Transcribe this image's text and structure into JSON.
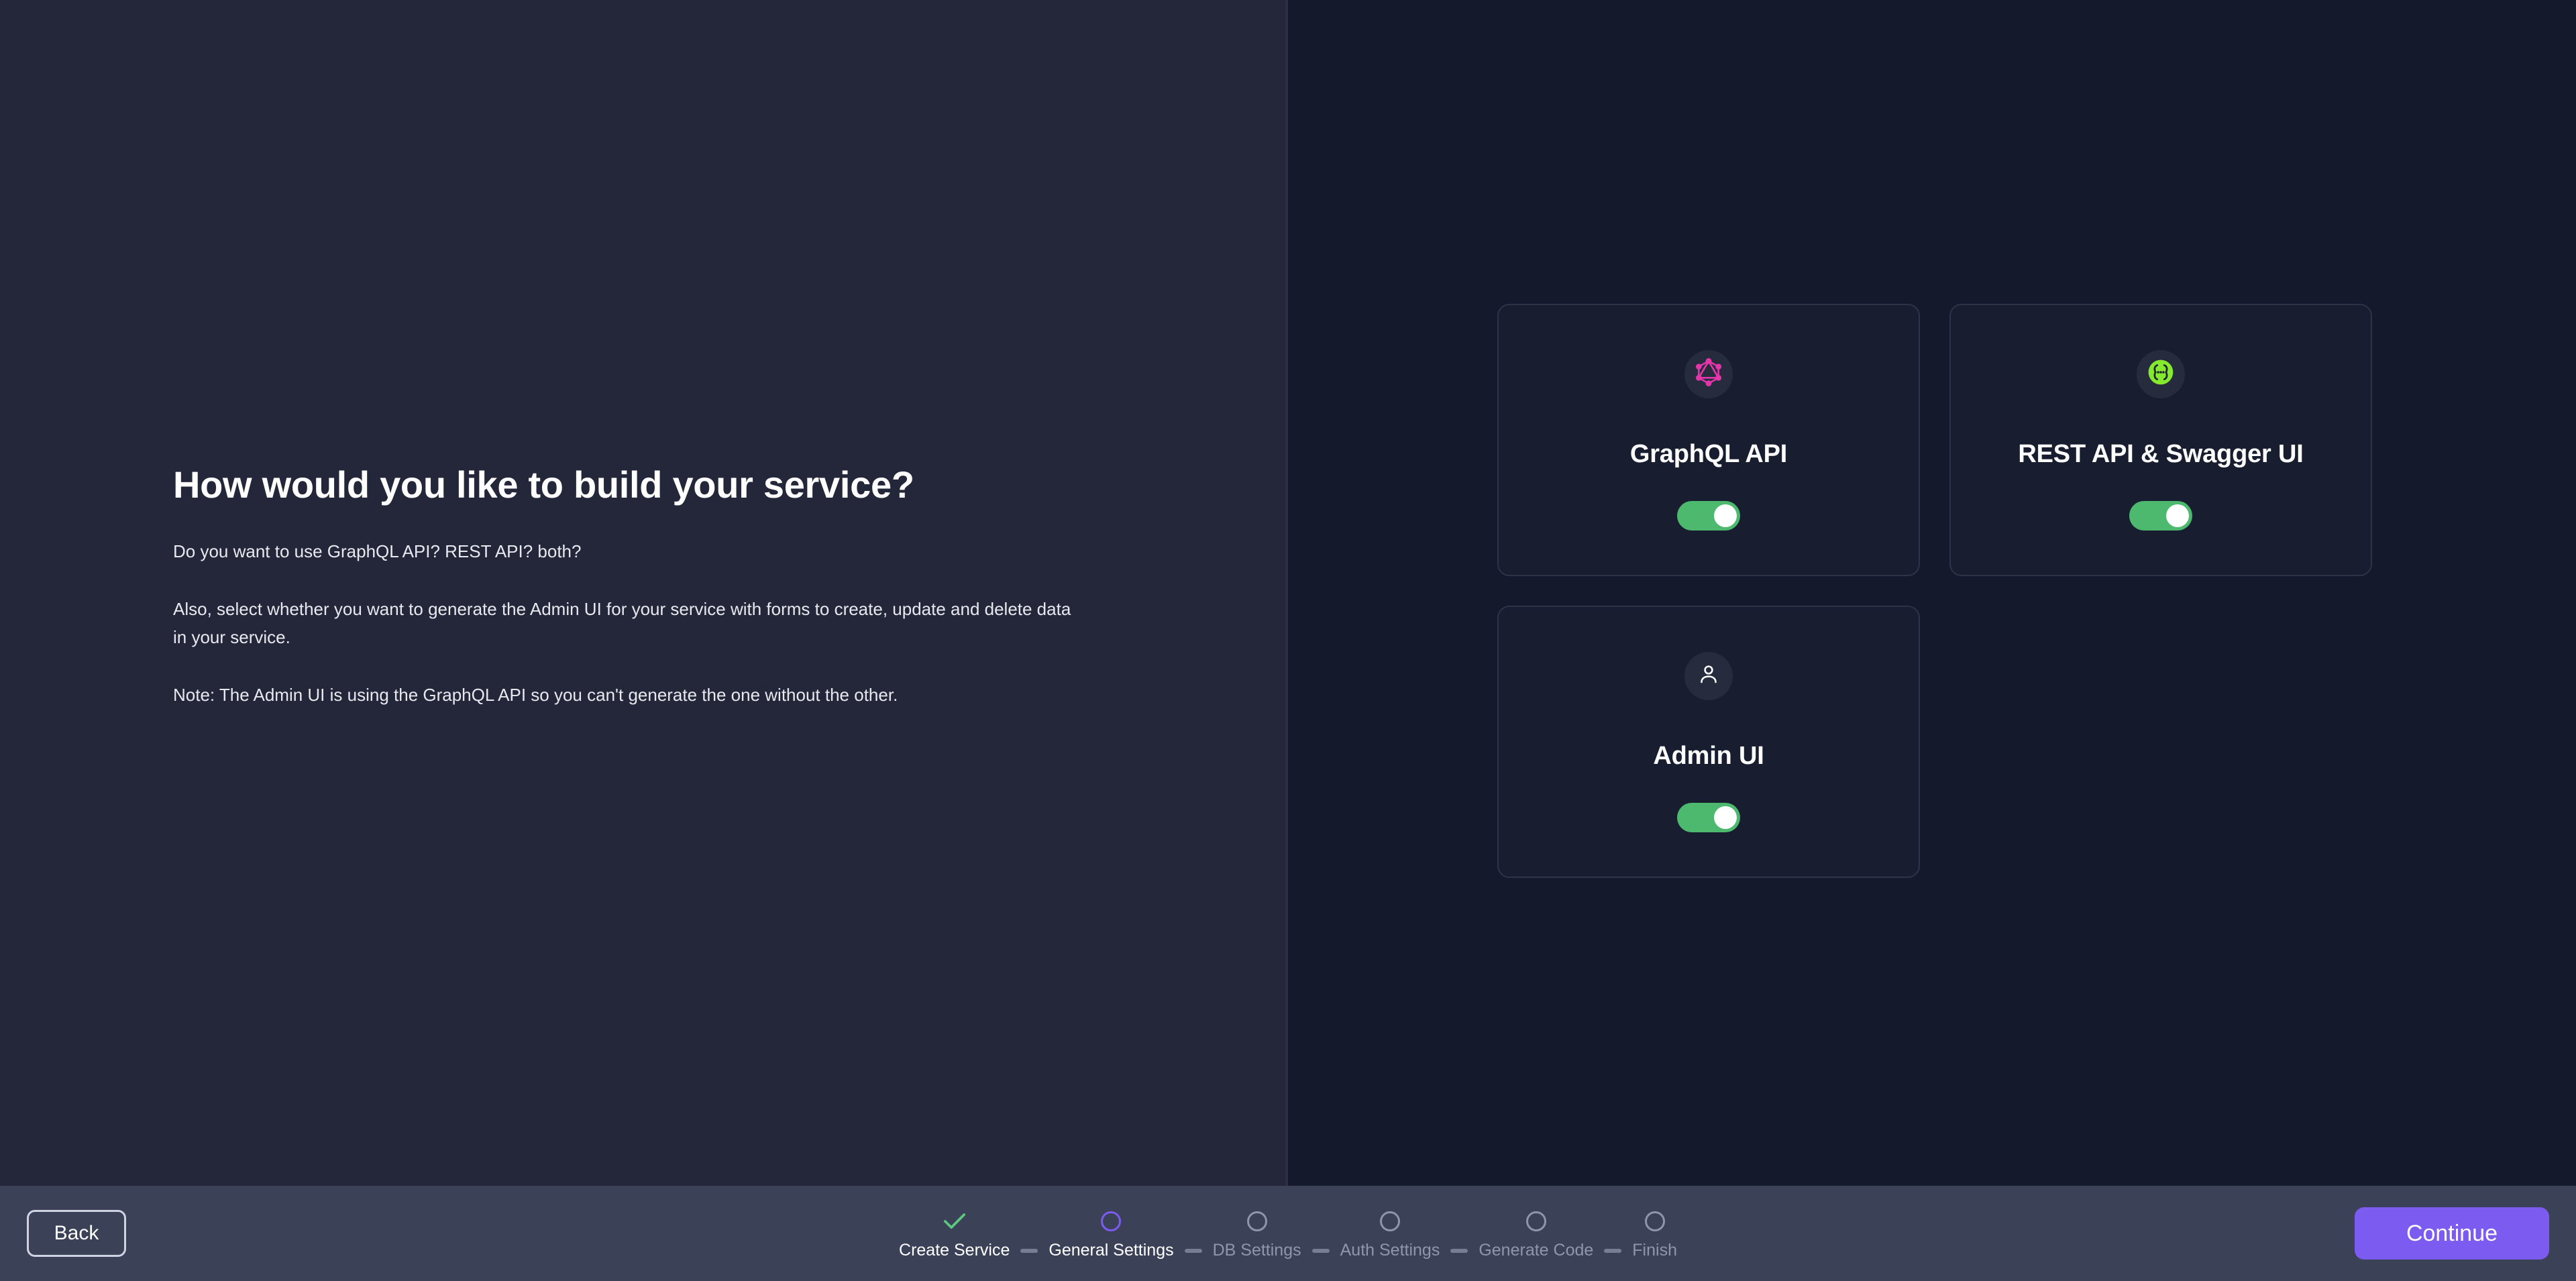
{
  "left": {
    "heading": "How would you like to build your service?",
    "paragraphs": [
      "Do you want to use GraphQL API? REST API? both?",
      "Also, select whether you want to generate the Admin UI for your service with forms to create, update and delete data in your service.",
      "Note: The Admin UI is using the GraphQL API so you can't generate the one without the other."
    ]
  },
  "cards": [
    {
      "title": "GraphQL API",
      "icon": "graphql-icon",
      "icon_color": "#e535ab",
      "toggle_state": "on",
      "toggle_label": "GraphQL API enabled"
    },
    {
      "title": "REST API & Swagger UI",
      "icon": "swagger-icon",
      "icon_color": "#85ea2d",
      "toggle_state": "on",
      "toggle_label": "REST API enabled"
    },
    {
      "title": "Admin UI",
      "icon": "user-icon",
      "icon_color": "#ffffff",
      "toggle_state": "on",
      "toggle_label": "Admin UI enabled"
    }
  ],
  "footer": {
    "back_label": "Back",
    "continue_label": "Continue",
    "accent_color": "#7c5cf0",
    "steps": [
      {
        "label": "Create Service",
        "state": "done"
      },
      {
        "label": "General Settings",
        "state": "current"
      },
      {
        "label": "DB Settings",
        "state": "pending"
      },
      {
        "label": "Auth Settings",
        "state": "pending"
      },
      {
        "label": "Generate Code",
        "state": "pending"
      },
      {
        "label": "Finish",
        "state": "pending"
      }
    ]
  },
  "theme": {
    "left_panel_bg": "#242739",
    "right_panel_bg": "#141a2b",
    "card_bg": "#181e30",
    "card_border": "#2d3448",
    "footer_bg": "#3b4258",
    "toggle_on": "#4cb96e",
    "check_green": "#5cc97e"
  }
}
